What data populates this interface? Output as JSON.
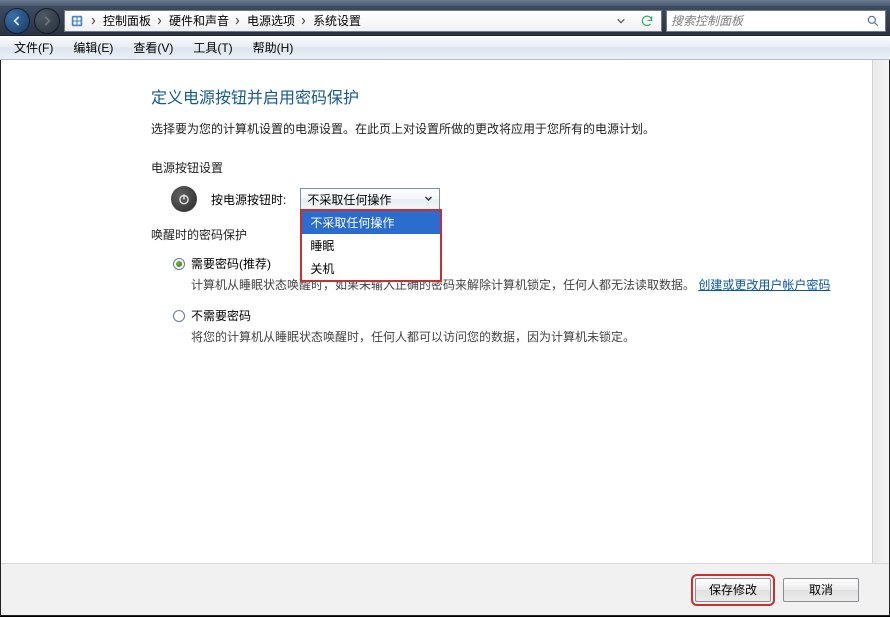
{
  "breadcrumb": {
    "root_icon": "control-panel-icon",
    "items": [
      "控制面板",
      "硬件和声音",
      "电源选项",
      "系统设置"
    ]
  },
  "search": {
    "placeholder": "搜索控制面板"
  },
  "menu": {
    "file": "文件(F)",
    "edit": "编辑(E)",
    "view": "查看(V)",
    "tools": "工具(T)",
    "help": "帮助(H)"
  },
  "page": {
    "title": "定义电源按钮并启用密码保护",
    "subtitle": "选择要为您的计算机设置的电源设置。在此页上对设置所做的更改将应用于您所有的电源计划。",
    "section_button": "电源按钮设置",
    "power_button_label": "按电源按钮时:",
    "combo_selected": "不采取任何操作",
    "combo_options": [
      "不采取任何操作",
      "睡眠",
      "关机"
    ],
    "section_wake": "唤醒时的密码保护",
    "radio1": {
      "label": "需要密码(推荐)",
      "desc_a": "计算机从睡眠状态唤醒时，如果未输入正确的密码来解除计算机锁定，任何人都无法读取数据。",
      "desc_link": "创建或更改用户帐户密码"
    },
    "radio2": {
      "label": "不需要密码",
      "desc": "将您的计算机从睡眠状态唤醒时，任何人都可以访问您的数据，因为计算机未锁定。"
    },
    "buttons": {
      "save": "保存修改",
      "cancel": "取消"
    }
  }
}
